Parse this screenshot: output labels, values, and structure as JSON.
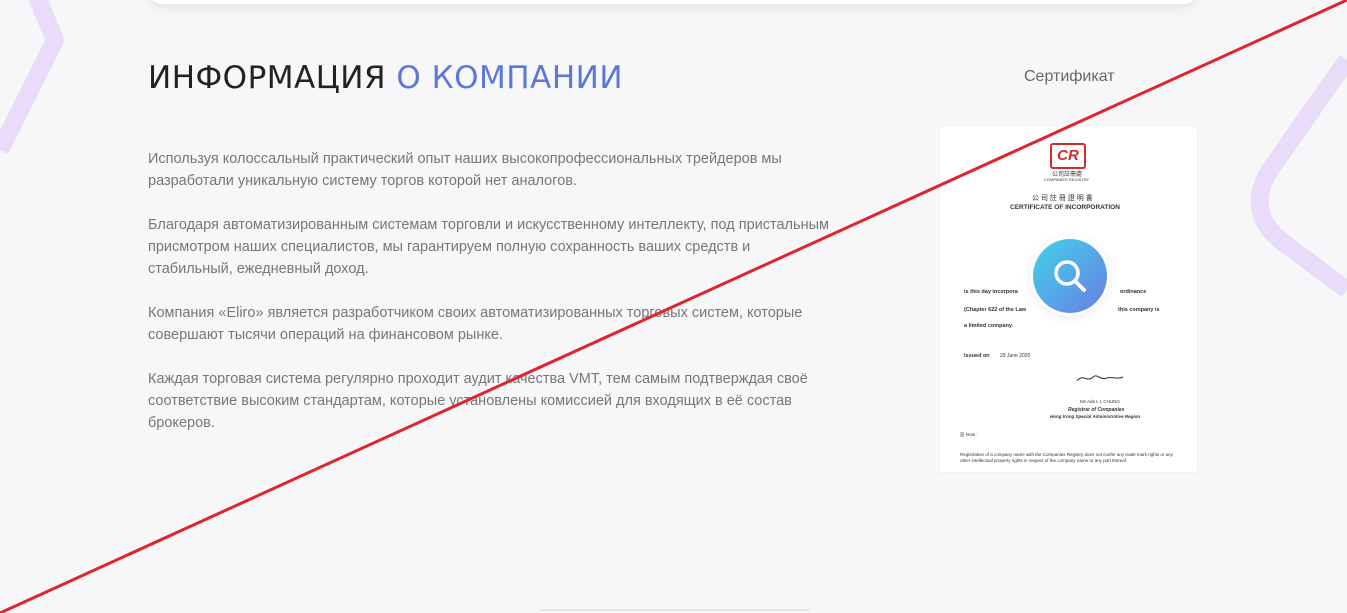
{
  "section": {
    "heading_main": "ИНФОРМАЦИЯ",
    "heading_accent": "О КОМПАНИИ",
    "certificate_label": "Сертификат"
  },
  "paragraphs": [
    "Используя колоссальный практический опыт наших высокопрофессиональных трейдеров мы разработали уникальную систему торгов которой нет аналогов.",
    "Благодаря автоматизированным системам торговли и искусственному интеллекту, под пристальным присмотром наших специалистов, мы гарантируем полную сохранность ваших средств и стабильный, ежедневный доход.",
    "Компания «Eliro» является разработчиком своих автоматизированных торговых систем, которые совершают тысячи операций на финансовом рынке.",
    "Каждая торговая система регулярно проходит аудит качества VMT, тем самым подтверждая своё соответствие высоким стандартам, которые установлены комиссией для входящих в её состав брокеров."
  ],
  "certificate": {
    "logo": "CR",
    "registry_cn": "公司註冊處",
    "registry_en": "COMPANIES REGISTRY",
    "title_cn": "公 司 註 冊 證 明 書",
    "title_en": "CERTIFICATE OF INCORPORATION",
    "line1": "is this day incorpora",
    "line1b": "ordinance",
    "line2": "(Chapter 622 of the Law",
    "line2b": "this company is",
    "line3": "a limited company.",
    "issued_label": "Issued on",
    "issued_date": "29 June 2020",
    "registrar_name": "Ms Ada L L CHUNG",
    "registrar_title": "Registrar of Companies",
    "registrar_region": "Hong Kong Special Administrative Region",
    "note_label": "註 Note :",
    "note_text": "Registration of a company name with the Companies Registry does not confer any trade mark rights or any other intellectual property rights in respect of the company name or any part thereof."
  },
  "icons": {
    "zoom": "magnifier-icon"
  },
  "colors": {
    "heading": "#222222",
    "accent": "#5b78d9",
    "body_text": "#777777",
    "zoom_gradient_start": "#3fd4e8",
    "zoom_gradient_end": "#6a7de6",
    "strike_line": "#e0242c"
  }
}
